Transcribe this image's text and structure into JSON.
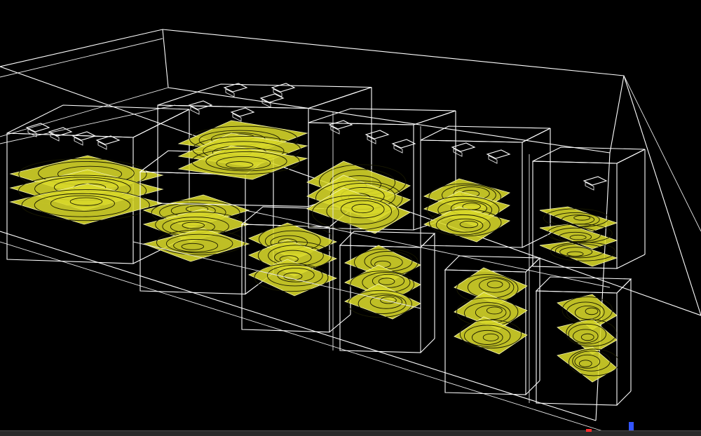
{
  "scene": {
    "background_color": "#000000",
    "wireframe_color": "#ffffff",
    "plane_color": "#d9d92a",
    "contour_color": "#1a1a00"
  }
}
